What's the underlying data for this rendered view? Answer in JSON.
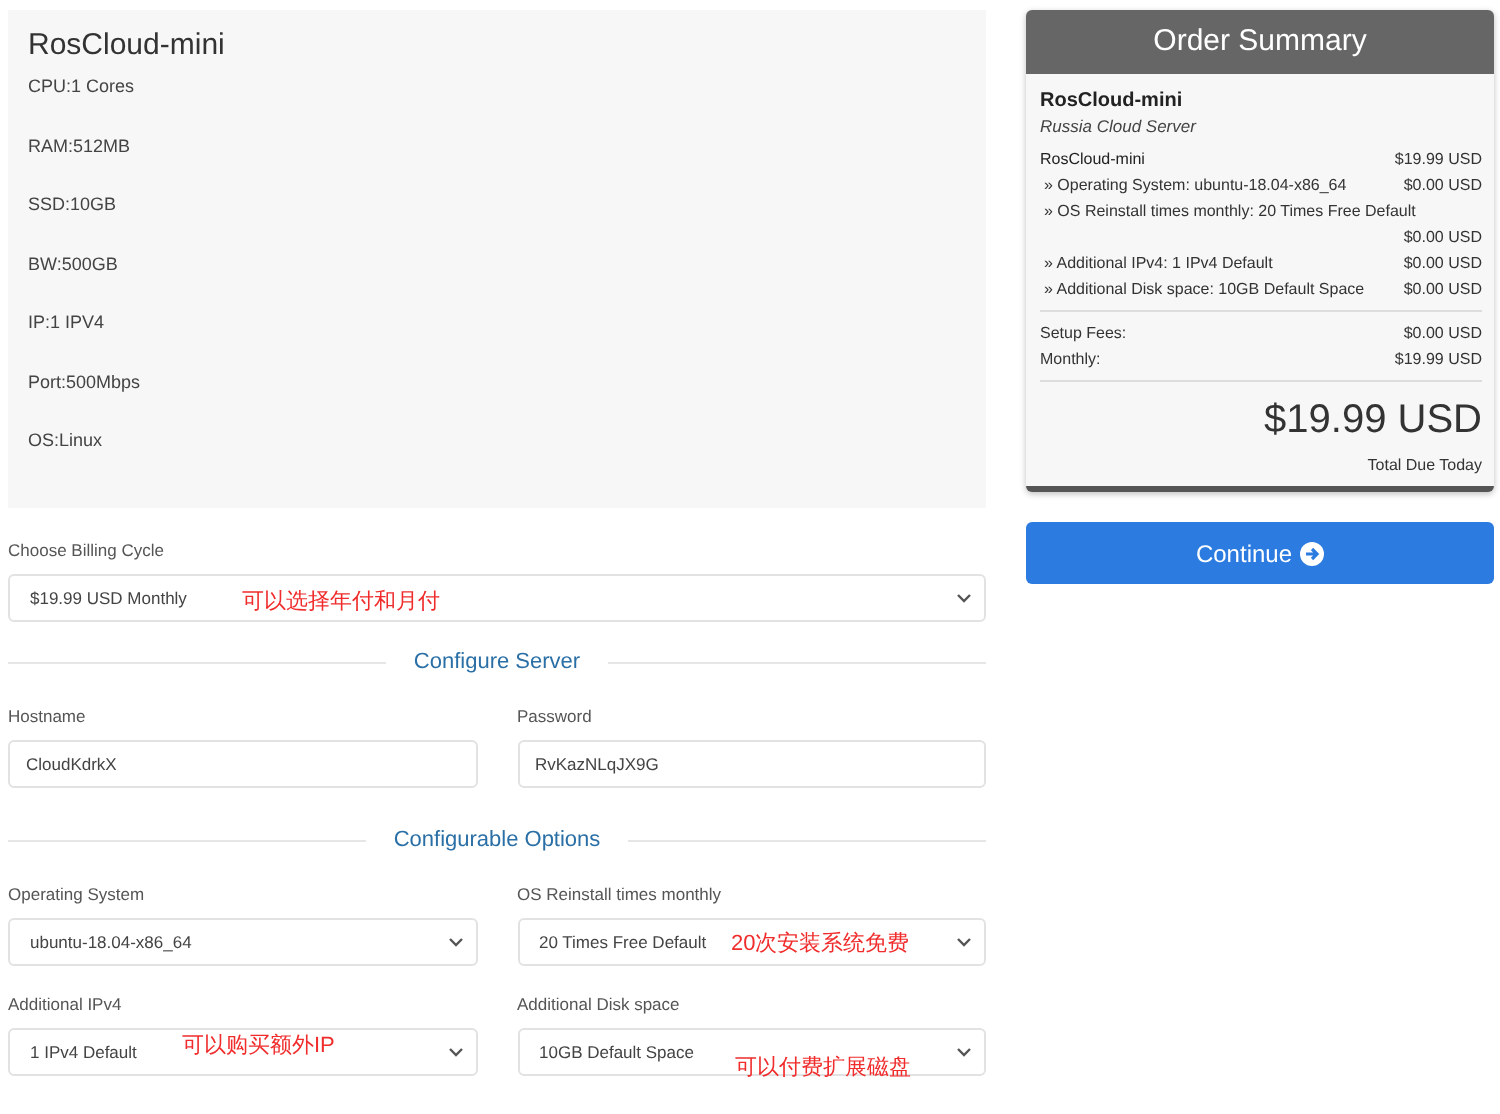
{
  "product": {
    "name": "RosCloud-mini",
    "specs": [
      "CPU:1 Cores",
      "RAM:512MB",
      "SSD:10GB",
      "BW:500GB",
      "IP:1 IPV4",
      "Port:500Mbps",
      "OS:Linux"
    ]
  },
  "billing": {
    "label": "Choose Billing Cycle",
    "value": "$19.99 USD Monthly",
    "annotation": "可以选择年付和月付"
  },
  "configure_server": {
    "heading": "Configure Server",
    "fields": [
      {
        "label": "Hostname",
        "value": "CloudKdrkX"
      },
      {
        "label": "Password",
        "value": "RvKazNLqJX9G"
      }
    ]
  },
  "configurable_options": {
    "heading": "Configurable Options",
    "fields": [
      {
        "label": "Operating System",
        "value": "ubuntu-18.04-x86_64"
      },
      {
        "label": "OS Reinstall times monthly",
        "value": "20 Times Free Default",
        "annotation": "20次安装系统免费"
      },
      {
        "label": "Additional IPv4",
        "value": "1 IPv4 Default",
        "annotation": "可以购买额外IP"
      },
      {
        "label": "Additional Disk space",
        "value": "10GB Default Space",
        "annotation": "可以付费扩展磁盘"
      }
    ]
  },
  "order_summary": {
    "title": "Order Summary",
    "product": "RosCloud-mini",
    "group": "Russia Cloud Server",
    "lines": [
      {
        "kind": "main",
        "label": "RosCloud-mini",
        "price": "$19.99 USD"
      },
      {
        "kind": "option",
        "label": "» Operating System: ubuntu-18.04-x86_64",
        "price": "$0.00 USD"
      },
      {
        "kind": "option",
        "label": "» OS Reinstall times monthly: 20 Times Free Default",
        "price": "$0.00 USD"
      },
      {
        "kind": "option",
        "label": "» Additional IPv4: 1 IPv4 Default",
        "price": "$0.00 USD"
      },
      {
        "kind": "option",
        "label": "» Additional Disk space: 10GB Default Space",
        "price": "$0.00 USD"
      }
    ],
    "fees": [
      {
        "label": "Setup Fees:",
        "price": "$0.00 USD"
      },
      {
        "label": "Monthly:",
        "price": "$19.99 USD"
      }
    ],
    "total": "$19.99 USD",
    "total_label": "Total Due Today"
  },
  "continue_button": {
    "label": "Continue"
  }
}
